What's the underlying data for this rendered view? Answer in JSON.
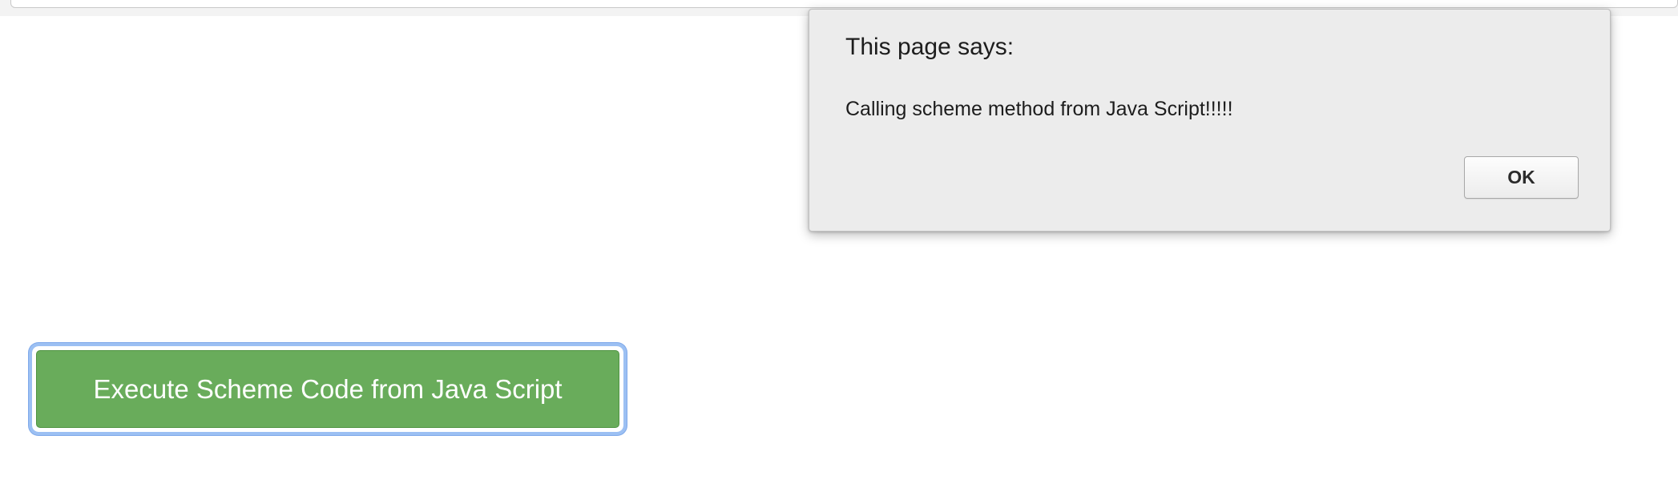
{
  "colors": {
    "button_green": "#69ac5b",
    "focus_ring_blue": "#9cc0f3",
    "dialog_background": "#ececec"
  },
  "main": {
    "execute_button_label": "Execute Scheme Code from Java Script"
  },
  "alert": {
    "title": "This page says:",
    "message": "Calling scheme method from Java Script!!!!!",
    "ok_label": "OK"
  }
}
